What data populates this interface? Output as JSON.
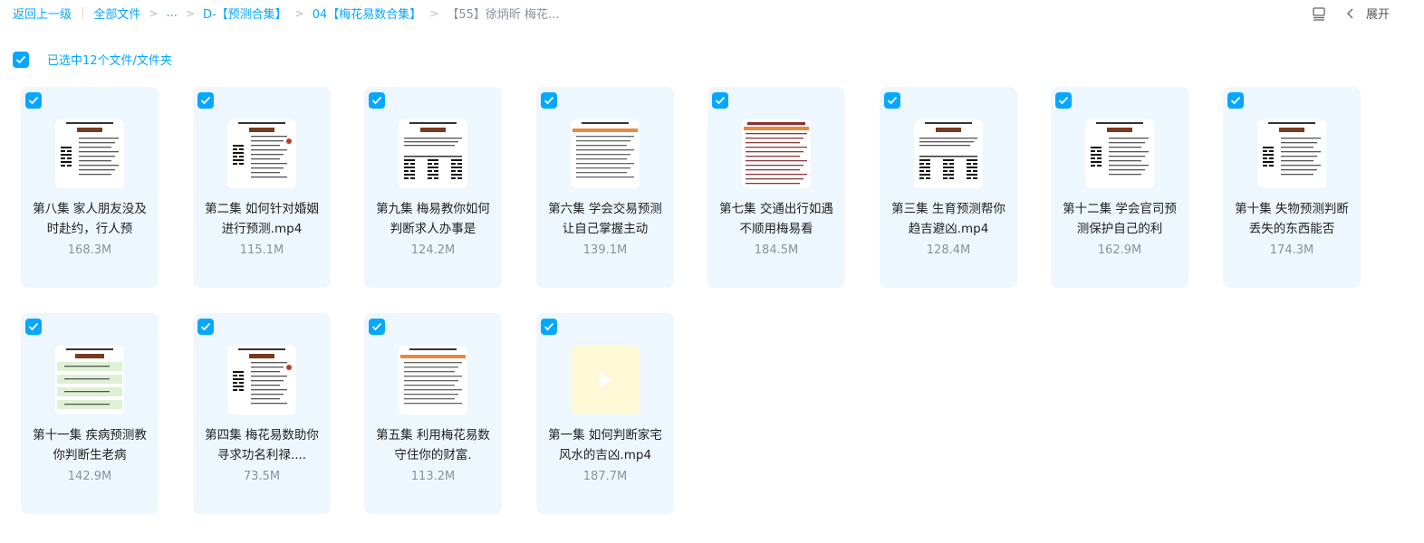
{
  "breadcrumb": {
    "back": "返回上一级",
    "all_files": "全部文件",
    "ellipsis": "...",
    "folder1": "D-【预测合集】",
    "folder2": "04【梅花易数合集】",
    "current": "【55】徐炳昕 梅花..."
  },
  "toolbar": {
    "expand": "展开"
  },
  "selection": {
    "text": "已选中12个文件/文件夹"
  },
  "files": [
    {
      "name": "第八集 家人朋友没及时赴约，行人预",
      "size": "168.3M",
      "thumb": "doc-a"
    },
    {
      "name": "第二集 如何针对婚姻进行预测.mp4",
      "size": "115.1M",
      "thumb": "doc-b"
    },
    {
      "name": "第九集 梅易教你如何判断求人办事是",
      "size": "124.2M",
      "thumb": "doc-c"
    },
    {
      "name": "第六集 学会交易预测让自己掌握主动",
      "size": "139.1M",
      "thumb": "doc-d"
    },
    {
      "name": "第七集 交通出行如遇不顺用梅易看",
      "size": "184.5M",
      "thumb": "doc-e"
    },
    {
      "name": "第三集 生育预测帮你趋吉避凶.mp4",
      "size": "128.4M",
      "thumb": "doc-c"
    },
    {
      "name": "第十二集 学会官司预测保护自己的利",
      "size": "162.9M",
      "thumb": "doc-a"
    },
    {
      "name": "第十集 失物预测判断丢失的东西能否",
      "size": "174.3M",
      "thumb": "doc-a"
    },
    {
      "name": "第十一集 疾病预测教你判断生老病",
      "size": "142.9M",
      "thumb": "doc-f"
    },
    {
      "name": "第四集 梅花易数助你寻求功名利禄....",
      "size": "73.5M",
      "thumb": "doc-b"
    },
    {
      "name": "第五集 利用梅花易数守住你的财富.",
      "size": "113.2M",
      "thumb": "doc-d"
    },
    {
      "name": "第一集 如何判断家宅风水的吉凶.mp4",
      "size": "187.7M",
      "thumb": "video"
    }
  ],
  "colors": {
    "accent": "#06a7ff",
    "card_bg": "#eef7fe",
    "thumb_bar": "#7a3a20"
  }
}
